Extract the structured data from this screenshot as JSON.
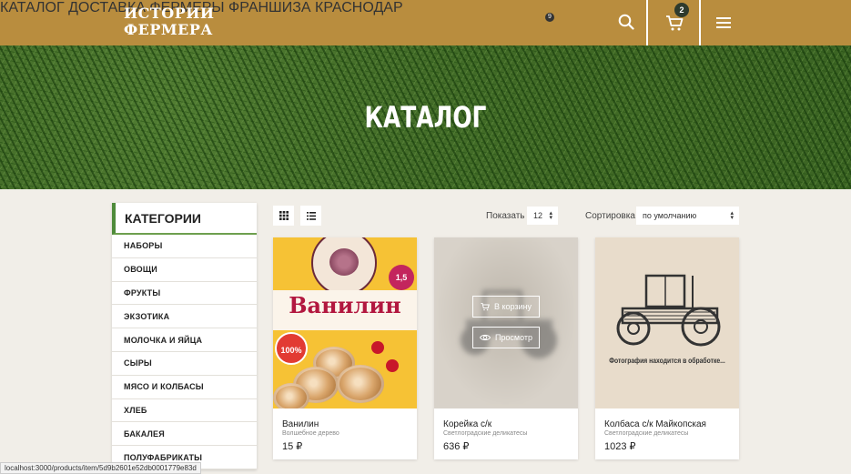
{
  "header": {
    "logo_line1": "ИСТОРИИ",
    "logo_line2": "ФЕРМЕРА",
    "nav": [
      "КАТАЛОГ",
      "ДОСТАВКА",
      "ФЕРМЕРЫ",
      "ФРАНШИЗА",
      "КРАСНОДАР"
    ],
    "city_badge": "9",
    "cart_count": "2",
    "colors": {
      "bar": "#b98d3e"
    }
  },
  "hero": {
    "title": "КАТАЛОГ"
  },
  "sidebar": {
    "title": "КАТЕГОРИИ",
    "items": [
      "НАБОРЫ",
      "ОВОЩИ",
      "ФРУКТЫ",
      "ЭКЗОТИКА",
      "МОЛОЧКА И ЯЙЦА",
      "СЫРЫ",
      "МЯСО И КОЛБАСЫ",
      "ХЛЕБ",
      "БАКАЛЕЯ",
      "ПОЛУФАБРИКАТЫ"
    ]
  },
  "toolbar": {
    "show_label": "Показать",
    "show_value": "12",
    "sort_label": "Сортировка",
    "sort_value": "по умолчанию"
  },
  "products": [
    {
      "name": "Ванилин",
      "maker": "Волшебное дерево",
      "price": "15 ₽",
      "image_text": "Ванилин",
      "badge": "1,5",
      "stamp": "100%"
    },
    {
      "name": "Корейка с/к",
      "maker": "Светлоградские деликатесы",
      "price": "636 ₽",
      "cart_button": "В корзину",
      "view_button": "Просмотр"
    },
    {
      "name": "Колбаса с/к Майкопская",
      "maker": "Светлоградские деликатесы",
      "price": "1023 ₽",
      "image_caption": "Фотография находится в обработке..."
    }
  ],
  "status_url": "localhost:3000/products/item/5d9b2601e52db0001779e83d"
}
